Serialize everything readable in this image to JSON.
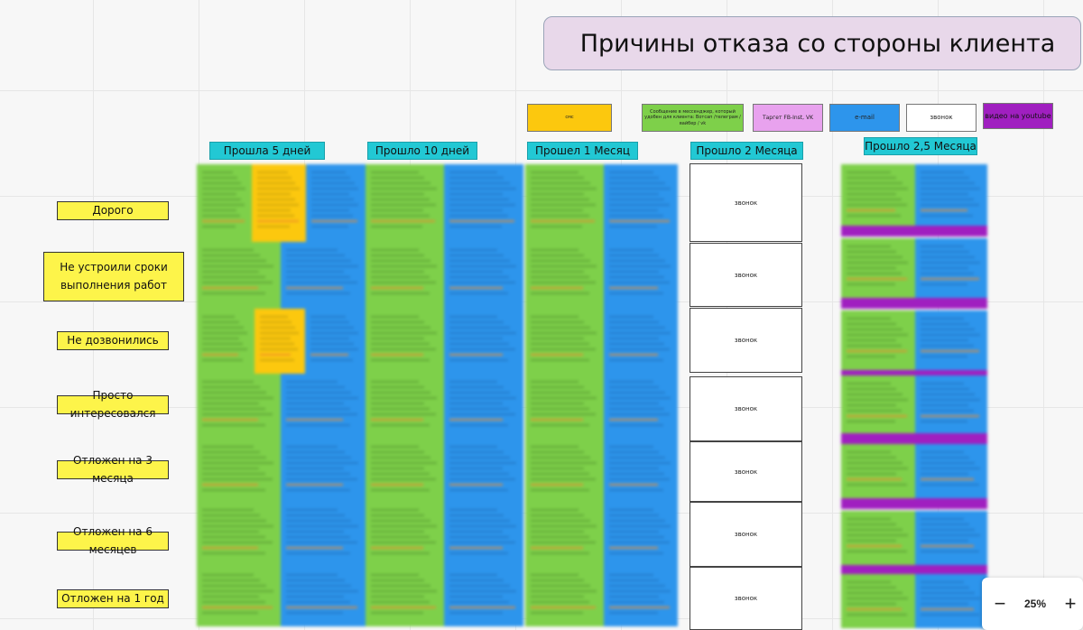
{
  "board_title": "Причины отказа со стороны клиента",
  "legend": [
    {
      "label": "смс",
      "color": "#fcc80e"
    },
    {
      "label": "Сообщение в мессенджер, который удобен для клиента: Вотсап /телеграм /вайбер / vk",
      "color": "#7ed04a"
    },
    {
      "label": "Таргет FB-Inst, VK",
      "color": "#e8a2ee"
    },
    {
      "label": "e-mail",
      "color": "#2d95ec"
    },
    {
      "label": "звонок",
      "color": "#ffffff"
    },
    {
      "label": "видео на youtube",
      "color": "#a01fc0"
    }
  ],
  "columns": [
    "Прошла 5 дней",
    "Прошло 10 дней",
    "Прошел 1 Месяц",
    "Прошло 2 Месяца",
    "Прошло 2,5 Месяца"
  ],
  "rows": [
    "Дорого",
    "Не устроили сроки выполнения работ",
    "Не дозвонились",
    "Просто интересовался",
    "Отложен на 3 месяца",
    "Отложен на 6 месяцев",
    "Отложен на 1 год"
  ],
  "call_card_label": "звонок",
  "zoom": {
    "minus": "−",
    "level": "25%",
    "plus": "+"
  }
}
